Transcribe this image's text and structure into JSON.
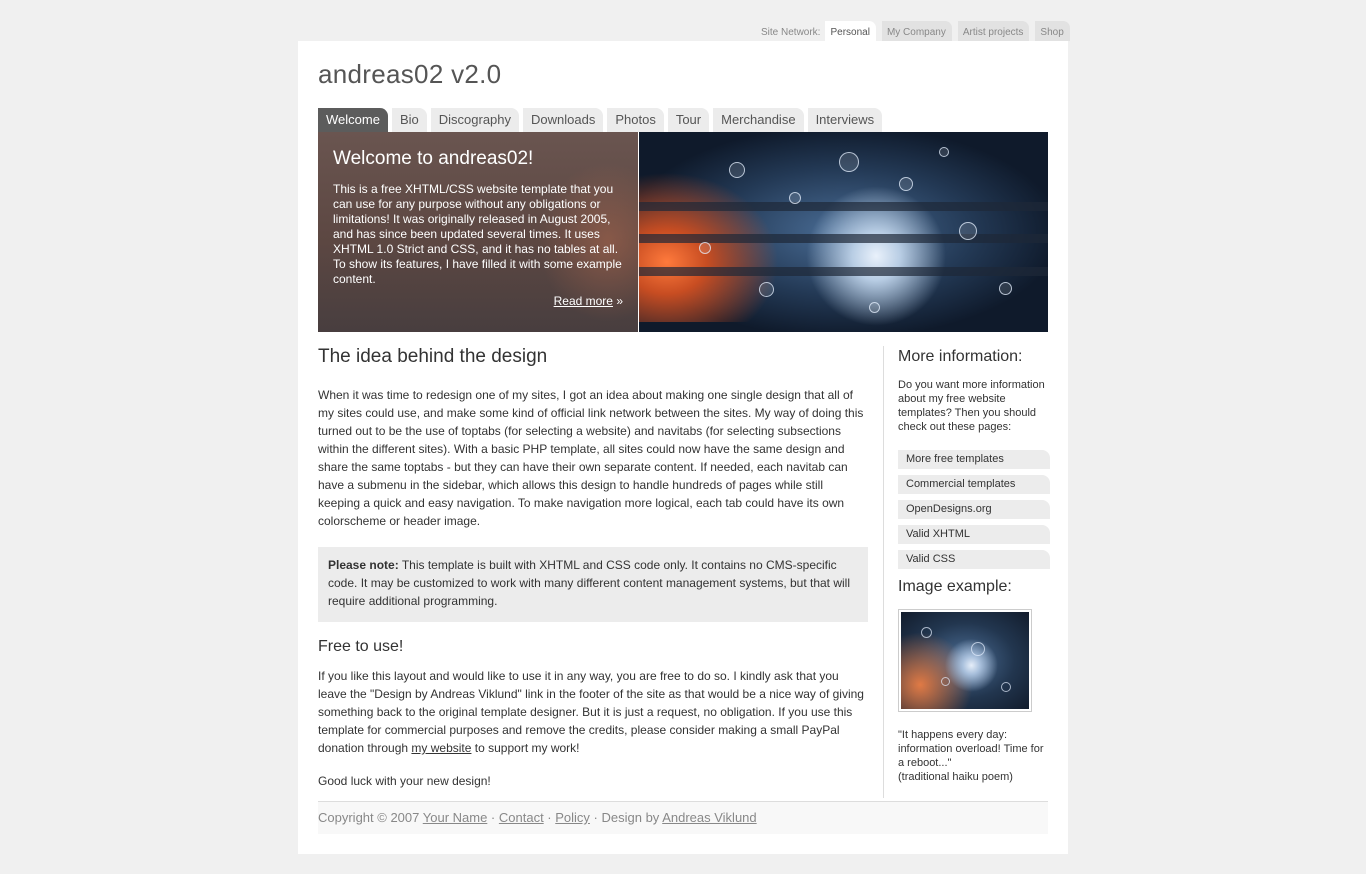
{
  "site_network": {
    "label": "Site Network:",
    "tabs": [
      "Personal",
      "My Company",
      "Artist projects",
      "Shop"
    ],
    "active": "Personal"
  },
  "site_title": "andreas02 v2.0",
  "navitabs": {
    "items": [
      "Welcome",
      "Bio",
      "Discography",
      "Downloads",
      "Photos",
      "Tour",
      "Merchandise",
      "Interviews"
    ],
    "active": "Welcome"
  },
  "header": {
    "title": "Welcome to andreas02!",
    "intro": "This is a free XHTML/CSS website template that you can use for any purpose without any obligations or limitations! It was originally released in August 2005, and has since been updated several times. It uses XHTML 1.0 Strict and CSS, and it has no tables at all. To show its features, I have filled it with some example content.",
    "read_more": "Read more",
    "read_more_suffix": " »"
  },
  "main": {
    "title": "The idea behind the design",
    "body": "When it was time to redesign one of my sites, I got an idea about making one single design that all of my sites could use, and make some kind of official link network between the sites. My way of doing this turned out to be the use of toptabs (for selecting a website) and navitabs (for selecting subsections within the different sites). With a basic PHP template, all sites could now have the same design and share the same toptabs - but they can have their own separate content. If needed, each navitab can have a submenu in the sidebar, which allows this design to handle hundreds of pages while still keeping a quick and easy navigation. To make navigation more logical, each tab could have its own colorscheme or header image.",
    "note_label": "Please note:",
    "note_text": " This template is built with XHTML and CSS code only. It contains no CMS-specific code. It may be customized to work with many different content management systems, but that will require additional programming.",
    "free_title": "Free to use!",
    "free_before": "If you like this layout and would like to use it in any way, you are free to do so. I kindly ask that you leave the \"Design by Andreas Viklund\" link in the footer of the site as that would be a nice way of giving something back to the original template designer. But it is just a request, no obligation. If you use this template for commercial purposes and remove the credits, please consider making a small PayPal donation through ",
    "free_link": "my website",
    "free_after": " to support my work!",
    "good_luck": "Good luck with your new design!"
  },
  "sidebar": {
    "more_title": "More information:",
    "more_text": "Do you want more information about my free website templates? Then you should check out these pages:",
    "links": [
      "More free templates",
      "Commercial templates",
      "OpenDesigns.org",
      "Valid XHTML",
      "Valid CSS"
    ],
    "image_title": "Image example:",
    "quote": "\"It happens every day: information overload! Time for a reboot...\"",
    "quote_source": "(traditional haiku poem)"
  },
  "footer": {
    "copyright": "Copyright © 2007 ",
    "your_name": "Your Name",
    "sep": " · ",
    "contact": "Contact",
    "policy": "Policy",
    "design_by": " · Design by ",
    "designer": "Andreas Viklund"
  }
}
